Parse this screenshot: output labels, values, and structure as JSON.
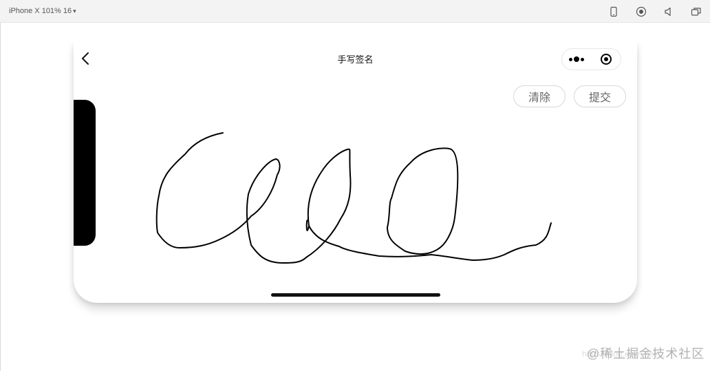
{
  "toolbar": {
    "device_label": "iPhone X 101% 16",
    "dropdown_caret": "▾",
    "icons": [
      "phone-icon",
      "record-icon",
      "volume-icon",
      "window-icon"
    ]
  },
  "nav": {
    "title": "手写签名",
    "back_icon": "chevron-left-icon",
    "capsule_icons": [
      "more-dots-icon",
      "close-target-icon"
    ]
  },
  "actions": {
    "clear_label": "清除",
    "submit_label": "提交"
  },
  "watermark": {
    "text": "@稀土掘金技术社区",
    "faint_text": "https://blog.csdn.net/..."
  },
  "colors": {
    "ink": "#000000",
    "button_text": "#666666",
    "button_border": "#d7d7d7",
    "toolbar_bg": "#f3f3f3"
  }
}
